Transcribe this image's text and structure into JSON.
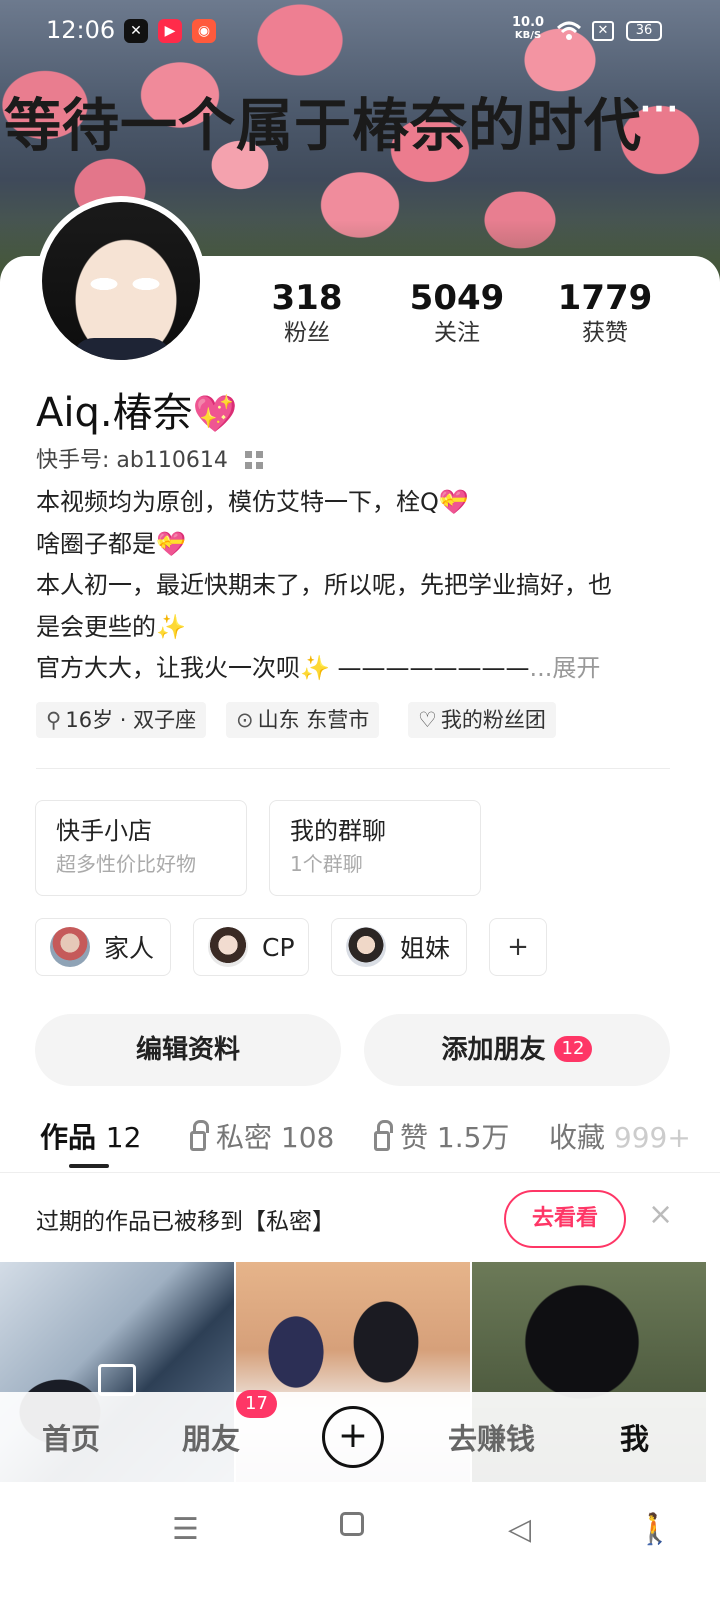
{
  "status_bar": {
    "time": "12:06",
    "net_speed_value": "10.0",
    "net_speed_unit": "KB/S",
    "battery": "36"
  },
  "banner": {
    "text": "等待一个属于椿奈的时代",
    "more_label": "···"
  },
  "profile": {
    "name": "Aiq.椿奈",
    "name_emoji": "💖",
    "uid_label": "快手号: ab110614",
    "stats": [
      {
        "value": "318",
        "label": "粉丝"
      },
      {
        "value": "5049",
        "label": "关注"
      },
      {
        "value": "1779",
        "label": "获赞"
      }
    ],
    "bio_lines": [
      "本视频均为原创，模仿艾特一下，栓Q💝",
      "啥圈子都是💝",
      "本人初一，最近快期末了，所以呢，先把学业搞好，也",
      "是会更些的✨",
      "官方大大，让我火一次呗✨ ————————"
    ],
    "bio_expand": "...展开",
    "tags": {
      "age": "16岁 · 双子座",
      "location": "山东 东营市",
      "fan_club": "我的粉丝团"
    }
  },
  "cards": {
    "shop": {
      "title": "快手小店",
      "subtitle": "超多性价比好物"
    },
    "group": {
      "title": "我的群聊",
      "subtitle": "1个群聊"
    }
  },
  "relations": [
    {
      "label": "家人"
    },
    {
      "label": "CP"
    },
    {
      "label": "姐妹"
    }
  ],
  "relation_add": "+",
  "actions": {
    "edit": "编辑资料",
    "add_friend": "添加朋友",
    "add_friend_badge": "12"
  },
  "tabs": {
    "works": "作品",
    "works_count": "12",
    "private": "私密 108",
    "likes": "赞 1.5万",
    "favorites": "收藏",
    "favorites_count": "999+"
  },
  "notice": {
    "text": "过期的作品已被移到【私密】",
    "button": "去看看",
    "close": "×"
  },
  "bottom_nav": {
    "home": "首页",
    "friends": "朋友",
    "friends_badge": "17",
    "plus": "+",
    "earn": "去赚钱",
    "me": "我"
  },
  "system_nav": {
    "menu": "☰",
    "back": "◁",
    "accessibility": "🚶"
  },
  "colors": {
    "accent": "#fe3666",
    "text": "#222222",
    "muted": "#999999"
  }
}
